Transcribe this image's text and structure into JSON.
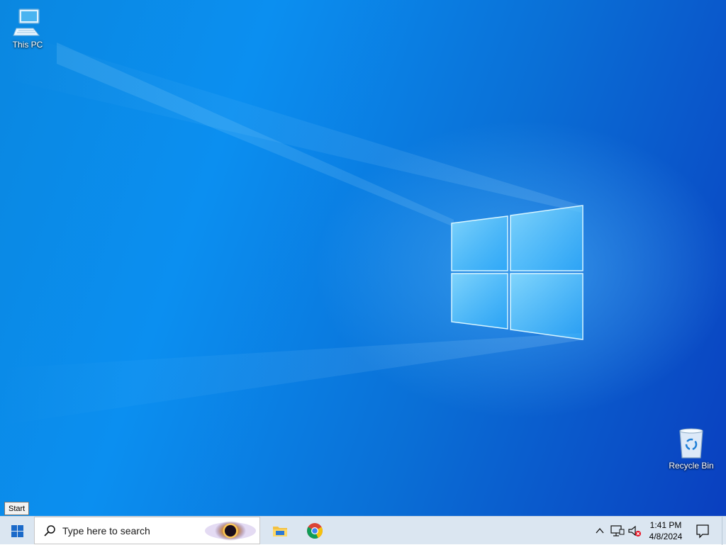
{
  "desktop": {
    "icons": [
      {
        "label": "This PC"
      },
      {
        "label": "Recycle Bin"
      }
    ]
  },
  "tooltip": {
    "text": "Start"
  },
  "taskbar": {
    "search_placeholder": "Type here to search",
    "pinned_apps": [
      "file-explorer",
      "google-chrome"
    ],
    "tray": {
      "time": "1:41 PM",
      "date": "4/8/2024"
    }
  },
  "colors": {
    "taskbar": "#dbe6f1",
    "wallpaper_accent": "#0a87e0",
    "wallpaper_dark": "#0a3fbf"
  }
}
